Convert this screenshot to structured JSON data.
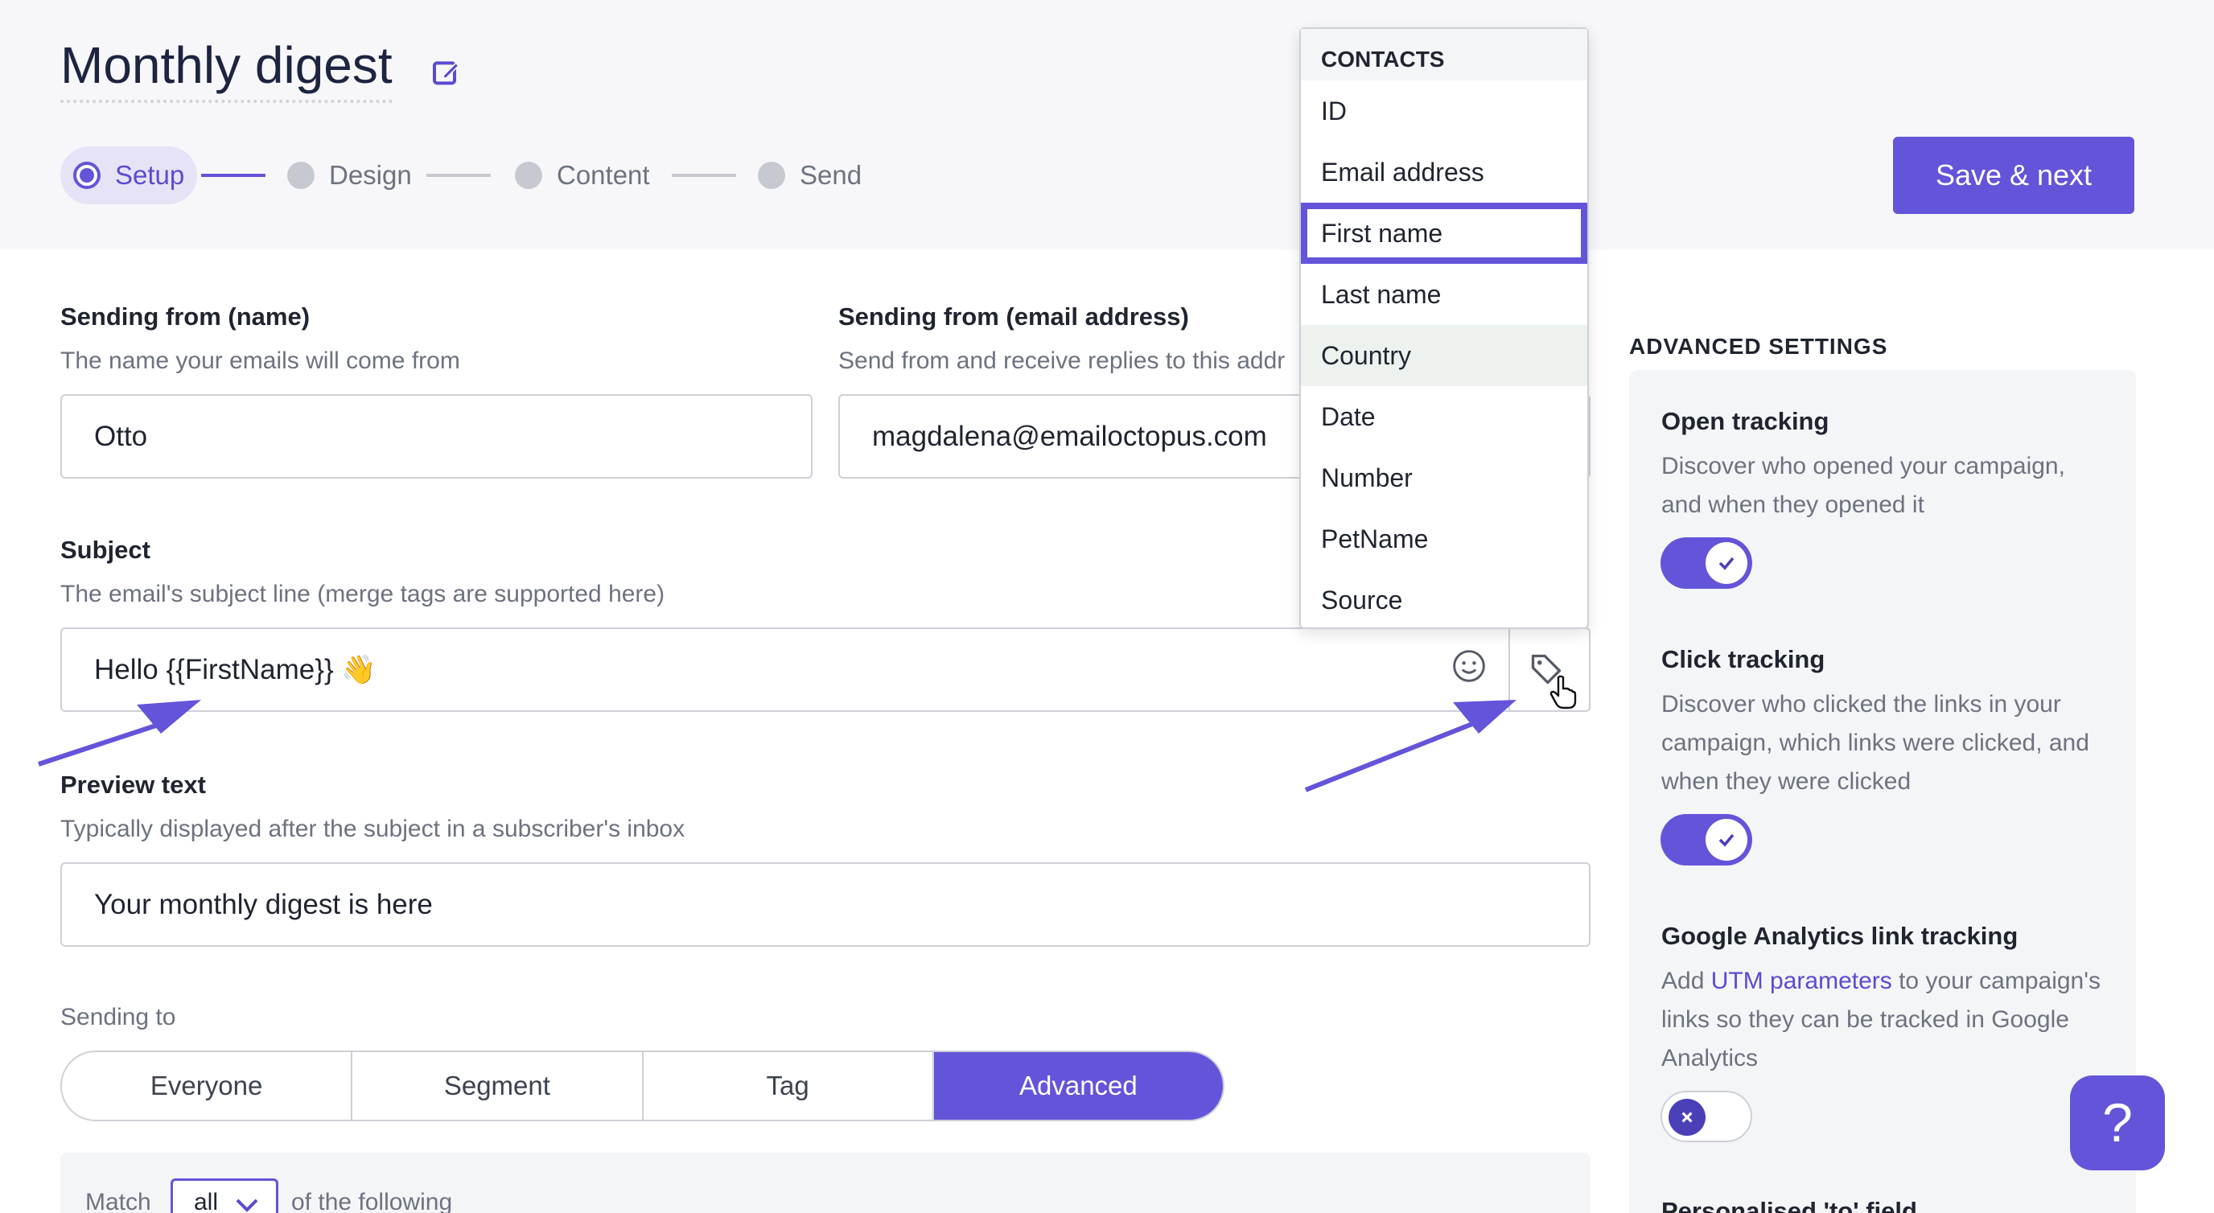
{
  "page": {
    "title": "Monthly digest"
  },
  "stepper": {
    "steps": [
      "Setup",
      "Design",
      "Content",
      "Send"
    ],
    "active": "Setup"
  },
  "toolbar": {
    "save_label": "Save & next"
  },
  "from_name": {
    "label": "Sending from (name)",
    "hint": "The name your emails will come from",
    "value": "Otto"
  },
  "from_email": {
    "label": "Sending from (email address)",
    "hint": "Send from and receive replies to this addr",
    "value": "magdalena@emailoctopus.com"
  },
  "subject": {
    "label": "Subject",
    "hint": "The email's subject line (merge tags are supported here)",
    "value": "Hello {{FirstName}} 👋"
  },
  "preview": {
    "label": "Preview text",
    "hint": "Typically displayed after the subject in a subscriber's inbox",
    "value": "Your monthly digest is here"
  },
  "sending_to": {
    "label": "Sending to",
    "options": [
      "Everyone",
      "Segment",
      "Tag",
      "Advanced"
    ],
    "selected": "Advanced"
  },
  "match": {
    "prefix": "Match",
    "value": "all",
    "suffix": "of the following"
  },
  "advanced": {
    "heading": "ADVANCED SETTINGS",
    "open": {
      "title": "Open tracking",
      "desc": "Discover who opened your campaign, and when they opened it",
      "enabled": true
    },
    "click": {
      "title": "Click tracking",
      "desc": "Discover who clicked the links in your campaign, which links were clicked, and when they were clicked",
      "enabled": true
    },
    "ga": {
      "title": "Google Analytics link tracking",
      "desc_pre": "Add ",
      "desc_link": "UTM parameters",
      "desc_post": " to your campaign's links so they can be tracked in Google Analytics",
      "enabled": false
    },
    "personalised_to": {
      "title": "Personalised 'to' field"
    }
  },
  "dropdown": {
    "header": "CONTACTS",
    "items": [
      "ID",
      "Email address",
      "First name",
      "Last name",
      "Country",
      "Date",
      "Number",
      "PetName",
      "Source"
    ],
    "selected": "First name",
    "hovered": "Country"
  },
  "help": {
    "label": "?"
  },
  "colors": {
    "accent": "#6454d9",
    "text": "#1f2430",
    "muted": "#6d7280",
    "border": "#cdd0d6"
  }
}
